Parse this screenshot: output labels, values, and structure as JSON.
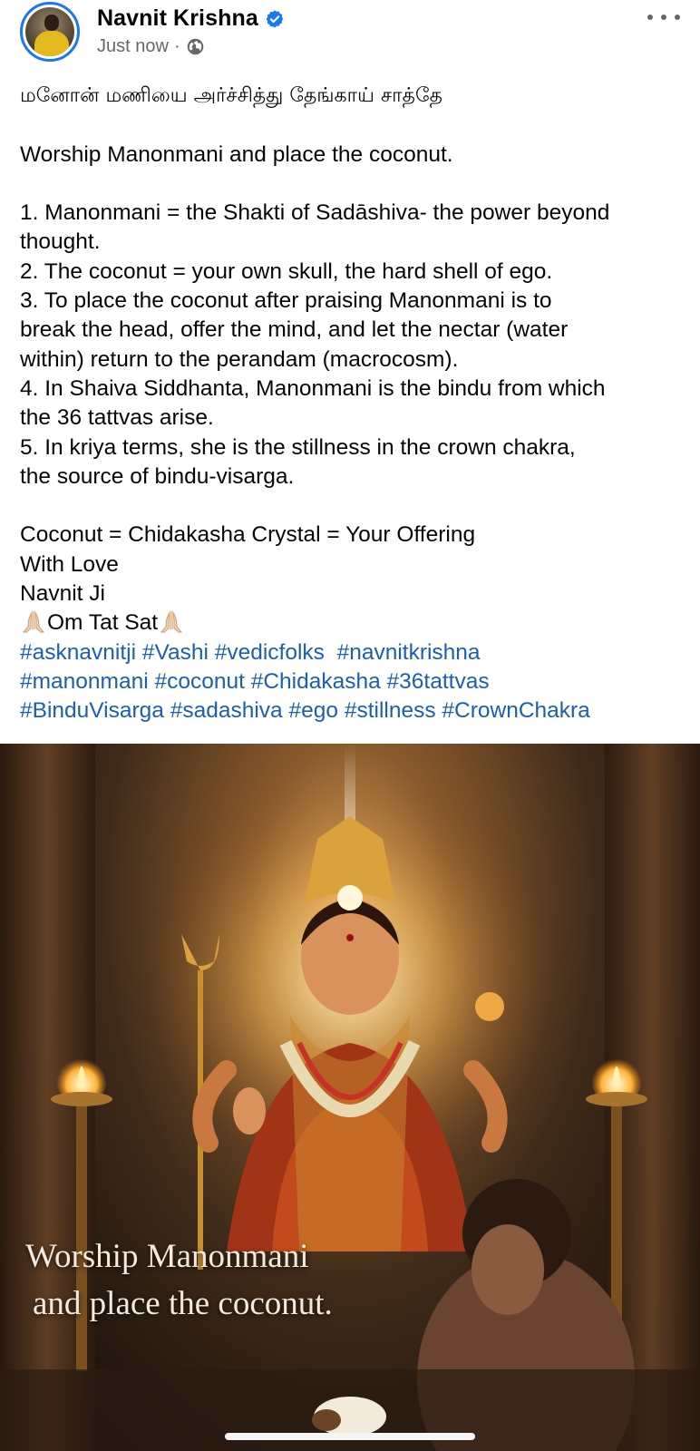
{
  "post": {
    "author": "Navnit Krishna",
    "verified_icon": "verified-badge-icon",
    "timestamp": "Just now",
    "separator": "·",
    "audience_icon": "globe-icon",
    "more_icon": "more-options-icon",
    "lines": [
      "மனோன் மணியை அர்ச்சித்து தேங்காய் சாத்தே",
      "",
      "Worship Manonmani and place the coconut.",
      "",
      "1. Manonmani = the Shakti of Sadāshiva- the power beyond",
      "thought.",
      "2. The coconut = your own skull, the hard shell of ego.",
      "3. To place the coconut after praising Manonmani is to",
      "break the head, offer the mind, and let the nectar (water",
      "within) return to the perandam (macrocosm).",
      "4. In Shaiva Siddhanta, Manonmani is the bindu from which",
      "the 36 tattvas arise.",
      "5. In kriya terms, she is the stillness in the crown chakra,",
      "the source of bindu-visarga.",
      "",
      "Coconut = Chidakasha Crystal = Your Offering",
      "With Love",
      "Navnit Ji"
    ],
    "closing_text": "Om Tat Sat",
    "hashtags_line1": [
      "#asknavnitji",
      "#Vashi",
      "#vedicfolks",
      "#navnitkrishna"
    ],
    "hashtags_line2": [
      "#manonmani",
      "#coconut",
      "#Chidakasha",
      "#36tattvas"
    ],
    "hashtags_line3": [
      "#BinduVisarga",
      "#sadashiva",
      "#ego",
      "#stillness",
      "#CrownChakra"
    ],
    "image_caption_line1": "Worship Manonmani",
    "image_caption_line2": "and place the coconut.",
    "link_color": "#1a5fb4",
    "verified_color": "#1877f2"
  }
}
